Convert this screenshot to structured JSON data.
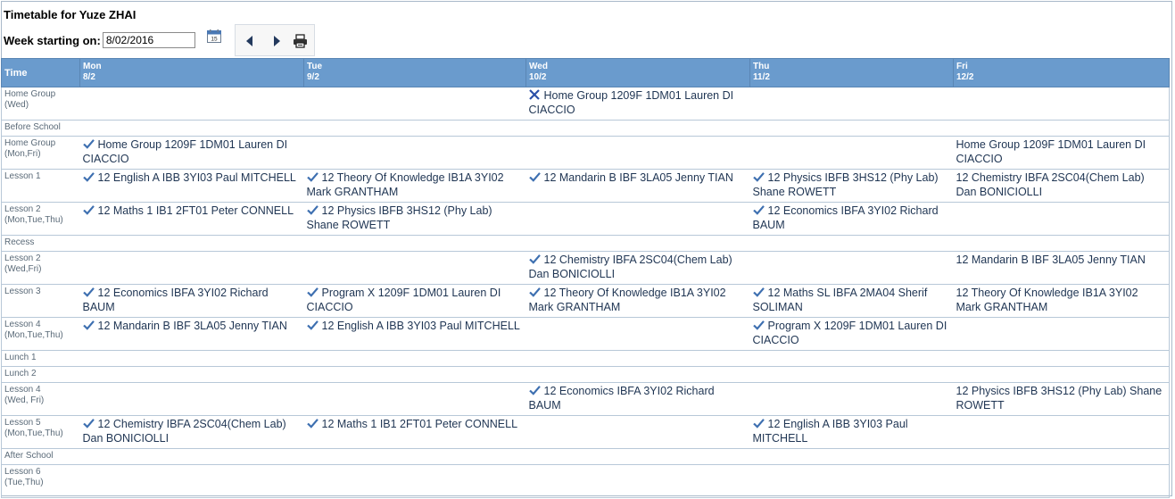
{
  "title": "Timetable for Yuze ZHAI",
  "week": {
    "label": "Week starting on:",
    "value": "8/02/2016"
  },
  "header": {
    "time_label": "Time",
    "days": [
      {
        "name": "Mon",
        "date": "8/2"
      },
      {
        "name": "Tue",
        "date": "9/2"
      },
      {
        "name": "Wed",
        "date": "10/2"
      },
      {
        "name": "Thu",
        "date": "11/2"
      },
      {
        "name": "Fri",
        "date": "12/2"
      }
    ]
  },
  "periods": [
    {
      "name": "Home Group",
      "sub": "(Wed)",
      "cells": [
        null,
        null,
        {
          "mark": "cross",
          "text": "Home Group 1209F 1DM01 Lauren DI CIACCIO"
        },
        null,
        null
      ]
    },
    {
      "name": "Before School",
      "sub": "",
      "cells": [
        null,
        null,
        null,
        null,
        null
      ]
    },
    {
      "name": "Home Group",
      "sub": "(Mon,Fri)",
      "cells": [
        {
          "mark": "check",
          "text": "Home Group 1209F 1DM01 Lauren DI CIACCIO"
        },
        null,
        null,
        null,
        {
          "mark": "",
          "text": "Home Group 1209F 1DM01 Lauren DI CIACCIO"
        }
      ]
    },
    {
      "name": "Lesson 1",
      "sub": "",
      "cells": [
        {
          "mark": "check",
          "text": "12 English A IBB 3YI03 Paul MITCHELL"
        },
        {
          "mark": "check",
          "text": "12 Theory Of Knowledge IB1A 3YI02 Mark GRANTHAM"
        },
        {
          "mark": "check",
          "text": "12 Mandarin B IBF 3LA05 Jenny TIAN"
        },
        {
          "mark": "check",
          "text": "12 Physics IBFB 3HS12 (Phy Lab) Shane ROWETT"
        },
        {
          "mark": "",
          "text": "12 Chemistry IBFA 2SC04(Chem Lab) Dan BONICIOLLI"
        }
      ]
    },
    {
      "name": "Lesson 2",
      "sub": "(Mon,Tue,Thu)",
      "cells": [
        {
          "mark": "check",
          "text": "12 Maths 1 IB1 2FT01 Peter CONNELL"
        },
        {
          "mark": "check",
          "text": "12 Physics IBFB 3HS12 (Phy Lab) Shane ROWETT"
        },
        null,
        {
          "mark": "check",
          "text": "12 Economics IBFA 3YI02 Richard BAUM"
        },
        null
      ]
    },
    {
      "name": "Recess",
      "sub": "",
      "cells": [
        null,
        null,
        null,
        null,
        null
      ]
    },
    {
      "name": "Lesson 2",
      "sub": "(Wed,Fri)",
      "cells": [
        null,
        null,
        {
          "mark": "check",
          "text": "12 Chemistry IBFA 2SC04(Chem Lab) Dan BONICIOLLI"
        },
        null,
        {
          "mark": "",
          "text": "12 Mandarin B IBF 3LA05 Jenny TIAN"
        }
      ]
    },
    {
      "name": "Lesson 3",
      "sub": "",
      "cells": [
        {
          "mark": "check",
          "text": "12 Economics IBFA 3YI02 Richard BAUM"
        },
        {
          "mark": "check",
          "text": "Program X 1209F 1DM01 Lauren DI CIACCIO"
        },
        {
          "mark": "check",
          "text": "12 Theory Of Knowledge IB1A 3YI02 Mark GRANTHAM"
        },
        {
          "mark": "check",
          "text": "12 Maths SL IBFA 2MA04 Sherif SOLIMAN"
        },
        {
          "mark": "",
          "text": "12 Theory Of Knowledge IB1A 3YI02 Mark GRANTHAM"
        }
      ]
    },
    {
      "name": "Lesson 4",
      "sub": "(Mon,Tue,Thu)",
      "cells": [
        {
          "mark": "check",
          "text": "12 Mandarin B IBF 3LA05 Jenny TIAN"
        },
        {
          "mark": "check",
          "text": "12 English A IBB 3YI03 Paul MITCHELL"
        },
        null,
        {
          "mark": "check",
          "text": "Program X 1209F 1DM01 Lauren DI CIACCIO"
        },
        null
      ]
    },
    {
      "name": "Lunch 1",
      "sub": "",
      "cells": [
        null,
        null,
        null,
        null,
        null
      ]
    },
    {
      "name": "Lunch 2",
      "sub": "",
      "cells": [
        null,
        null,
        null,
        null,
        null
      ]
    },
    {
      "name": "Lesson 4",
      "sub": "(Wed, Fri)",
      "cells": [
        null,
        null,
        {
          "mark": "check",
          "text": "12 Economics IBFA 3YI02 Richard BAUM"
        },
        null,
        {
          "mark": "",
          "text": "12 Physics IBFB 3HS12 (Phy Lab) Shane ROWETT"
        }
      ]
    },
    {
      "name": "Lesson 5",
      "sub": "(Mon,Tue,Thu)",
      "cells": [
        {
          "mark": "check",
          "text": "12 Chemistry IBFA 2SC04(Chem Lab) Dan BONICIOLLI"
        },
        {
          "mark": "check",
          "text": "12 Maths 1 IB1 2FT01 Peter CONNELL"
        },
        null,
        {
          "mark": "check",
          "text": "12 English A IBB 3YI03 Paul MITCHELL"
        },
        null
      ]
    },
    {
      "name": "After School",
      "sub": "",
      "cells": [
        null,
        null,
        null,
        null,
        null
      ]
    },
    {
      "name": "Lesson 6",
      "sub": "(Tue,Thu)",
      "cells": [
        null,
        null,
        null,
        null,
        null
      ]
    }
  ],
  "icons": {
    "calendar": "calendar-icon",
    "prev": "arrow-left-icon",
    "next": "arrow-right-icon",
    "print": "printer-icon",
    "check": "check-icon",
    "cross": "cross-icon"
  },
  "colors": {
    "header_bg": "#6a9bcd",
    "header_text": "#ffffff",
    "cell_text": "#1f3553",
    "check": "#3d6fb0",
    "cross": "#2a4fa8"
  }
}
